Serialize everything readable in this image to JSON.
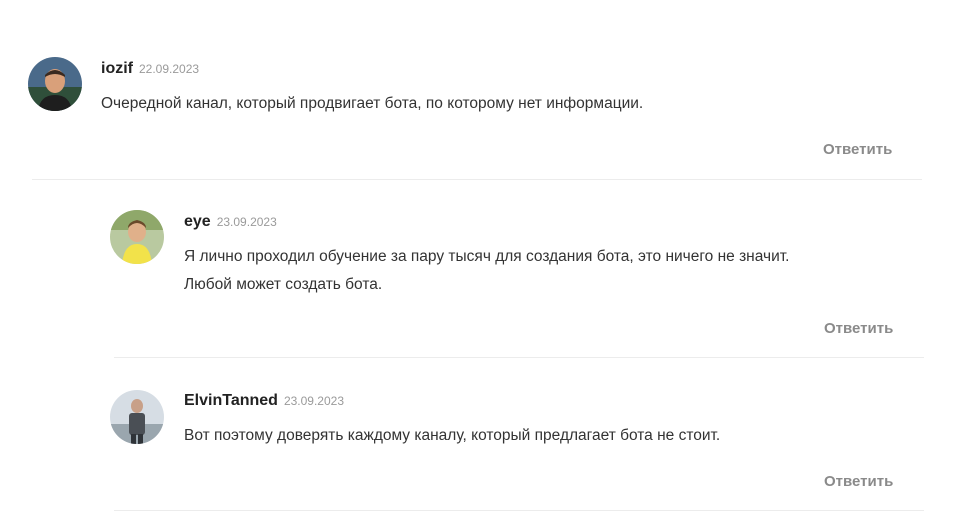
{
  "comments": [
    {
      "author": "iozif",
      "date": "22.09.2023",
      "text_lines": [
        "Очередной канал, который продвигает бота, по которому нет информации."
      ],
      "reply_label": "Ответить"
    },
    {
      "author": "eye",
      "date": "23.09.2023",
      "text_lines": [
        "Я лично проходил обучение за пару тысяч для создания бота, это ничего не значит.",
        "Любой может создать бота."
      ],
      "reply_label": "Ответить"
    },
    {
      "author": "ElvinTanned",
      "date": "23.09.2023",
      "text_lines": [
        "Вот поэтому доверять каждому каналу, который предлагает бота не стоит."
      ],
      "reply_label": "Ответить"
    }
  ],
  "colors": {
    "author": "#222222",
    "date": "#9a9a9a",
    "text": "#333333",
    "reply": "#8a8a8a",
    "divider": "#ececec"
  },
  "icons": [
    "avatar-iozif",
    "avatar-eye",
    "avatar-elvintanned"
  ]
}
